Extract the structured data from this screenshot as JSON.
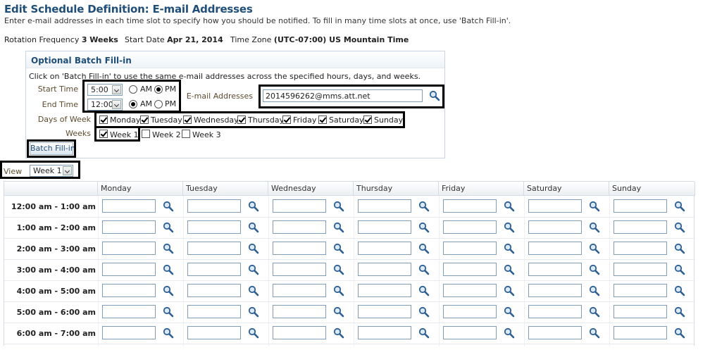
{
  "page": {
    "title": "Edit Schedule Definition: E-mail Addresses",
    "instructions": "Enter e-mail addresses in each time slot to specify how you should be notified. To fill in many time slots at once, use 'Batch Fill-in'."
  },
  "info": {
    "rotation_label": "Rotation Frequency",
    "rotation_value": "3 Weeks",
    "start_label": "Start Date",
    "start_value": "Apr 21, 2014",
    "tz_label": "Time Zone",
    "tz_value": "(UTC-07:00) US Mountain Time"
  },
  "batch": {
    "title": "Optional Batch Fill-in",
    "hint": "Click on 'Batch Fill-in' to use the same e-mail addresses across the specified hours, days, and weeks.",
    "start_time_label": "Start Time",
    "start_time_value": "5:00",
    "end_time_label": "End Time",
    "end_time_value": "12:00",
    "am_label": "AM",
    "pm_label": "PM",
    "email_label": "E-mail Addresses",
    "email_value": "2014596262@mms.att.net",
    "days_label": "Days of Week",
    "days": [
      "Monday",
      "Tuesday",
      "Wednesday",
      "Thursday",
      "Friday",
      "Saturday",
      "Sunday"
    ],
    "weeks_label": "Weeks",
    "weeks": [
      "Week 1",
      "Week 2",
      "Week 3"
    ],
    "button_label": "Batch Fill-in"
  },
  "view": {
    "label": "View",
    "value": "Week 1"
  },
  "grid": {
    "columns": [
      "Monday",
      "Tuesday",
      "Wednesday",
      "Thursday",
      "Friday",
      "Saturday",
      "Sunday"
    ],
    "rows": [
      "12:00 am - 1:00 am",
      "1:00 am - 2:00 am",
      "2:00 am - 3:00 am",
      "3:00 am - 4:00 am",
      "4:00 am - 5:00 am",
      "5:00 am - 6:00 am",
      "6:00 am - 7:00 am"
    ]
  }
}
